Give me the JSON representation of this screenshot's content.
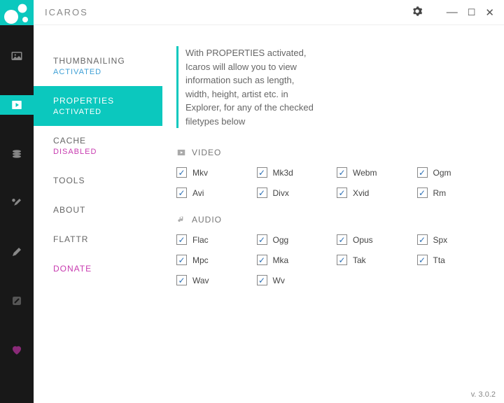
{
  "app": {
    "title": "ICAROS"
  },
  "nav": {
    "items": [
      {
        "label": "THUMBNAILING",
        "status": "ACTIVATED",
        "status_class": "st-activated"
      },
      {
        "label": "PROPERTIES",
        "status": "ACTIVATED",
        "status_class": "st-activated"
      },
      {
        "label": "CACHE",
        "status": "DISABLED",
        "status_class": "st-disabled"
      },
      {
        "label": "TOOLS",
        "status": ""
      },
      {
        "label": "ABOUT",
        "status": ""
      },
      {
        "label": "FLATTR",
        "status": ""
      },
      {
        "label": "DONATE",
        "status": ""
      }
    ]
  },
  "description": "With  PROPERTIES activated, Icaros will allow you to view information such as length, width, height, artist etc. in Explorer, for any of the checked filetypes below",
  "sections": {
    "video": {
      "title": "VIDEO",
      "items": [
        "Mkv",
        "Mk3d",
        "Webm",
        "Ogm",
        "Avi",
        "Divx",
        "Xvid",
        "Rm"
      ]
    },
    "audio": {
      "title": "AUDIO",
      "items": [
        "Flac",
        "Ogg",
        "Opus",
        "Spx",
        "Mpc",
        "Mka",
        "Tak",
        "Tta",
        "Wav",
        "Wv"
      ]
    }
  },
  "version": "v. 3.0.2",
  "checkmark": "✓"
}
